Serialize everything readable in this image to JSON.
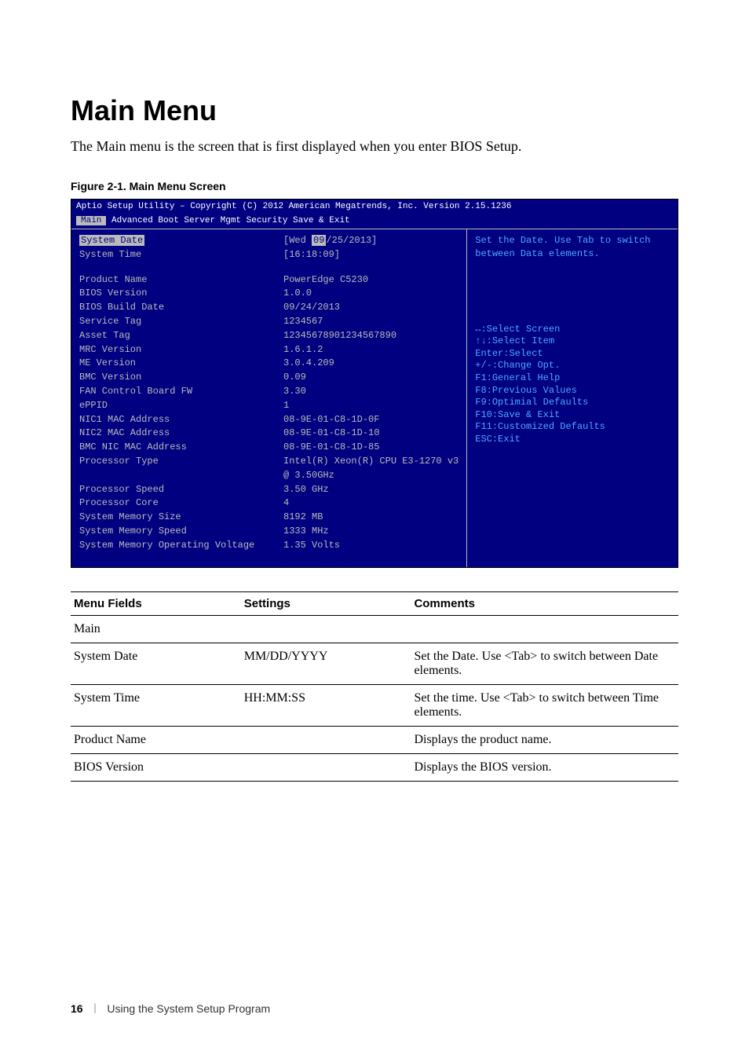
{
  "heading": "Main Menu",
  "intro": "The Main menu is the screen that is first displayed when you enter BIOS Setup.",
  "figure_label": "Figure 2-1.    Main Menu Screen",
  "bios": {
    "header": "Aptio Setup Utility – Copyright (C) 2012 American Megatrends, Inc.  Version 2.15.1236",
    "tabs_active": "Main",
    "tabs_rest": " Advanced  Boot  Server Mgmt  Security  Save & Exit",
    "rows": [
      {
        "label": "System Date",
        "value_prefix": "[Wed ",
        "value_sel": "09",
        "value_suffix": "/25/2013]",
        "selected_label": true
      },
      {
        "label": "System Time",
        "value": "[16:18:09]"
      },
      {
        "spacer": true
      },
      {
        "label": "Product Name",
        "value": "PowerEdge C5230"
      },
      {
        "label": "BIOS Version",
        "value": "1.0.0"
      },
      {
        "label": "BIOS Build Date",
        "value": "09/24/2013"
      },
      {
        "label": "Service Tag",
        "value": "1234567"
      },
      {
        "label": "Asset Tag",
        "value": "12345678901234567890"
      },
      {
        "label": "MRC Version",
        "value": "1.6.1.2"
      },
      {
        "label": "ME Version",
        "value": "3.0.4.209"
      },
      {
        "label": "BMC Version",
        "value": "0.09"
      },
      {
        "label": "FAN Control Board FW",
        "value": "3.30"
      },
      {
        "label": "ePPID",
        "value": "1"
      },
      {
        "label": "NIC1 MAC Address",
        "value": "08-9E-01-C8-1D-0F"
      },
      {
        "label": "NIC2 MAC Address",
        "value": "08-9E-01-C8-1D-10"
      },
      {
        "label": "BMC NIC MAC Address",
        "value": "08-9E-01-C8-1D-85"
      },
      {
        "label": "Processor Type",
        "value": "Intel(R) Xeon(R) CPU E3-1270 v3"
      },
      {
        "label": "",
        "value": "@ 3.50GHz"
      },
      {
        "label": "Processor Speed",
        "value": "3.50 GHz"
      },
      {
        "label": "Processor Core",
        "value": "4"
      },
      {
        "label": "System Memory Size",
        "value": "8192 MB"
      },
      {
        "label": "System Memory Speed",
        "value": "1333 MHz"
      },
      {
        "label": "System Memory Operating Voltage",
        "value": "1.35 Volts"
      }
    ],
    "help": "Set the Date. Use Tab to switch between Data elements.",
    "nav": [
      "↔:Select Screen",
      "↑↓:Select Item",
      "Enter:Select",
      "+/-:Change Opt.",
      "F1:General Help",
      "F8:Previous Values",
      "F9:Optimial Defaults",
      "F10:Save & Exit",
      "F11:Customized Defaults",
      "ESC:Exit"
    ]
  },
  "table": {
    "headers": [
      "Menu Fields",
      "Settings",
      "Comments"
    ],
    "rows": [
      {
        "c1": "Main",
        "c2": "",
        "c3": ""
      },
      {
        "c1": "System Date",
        "c2": "MM/DD/YYYY",
        "c3": "Set the Date. Use <Tab> to switch between Date elements."
      },
      {
        "c1": "System Time",
        "c2": "HH:MM:SS",
        "c3": "Set the time. Use <Tab> to switch between Time elements."
      },
      {
        "c1": "Product Name",
        "c2": "",
        "c3": "Displays the product name."
      },
      {
        "c1": "BIOS Version",
        "c2": "",
        "c3": "Displays the BIOS version."
      }
    ]
  },
  "footer": {
    "page": "16",
    "sep": "|",
    "title": "Using the System Setup Program"
  }
}
